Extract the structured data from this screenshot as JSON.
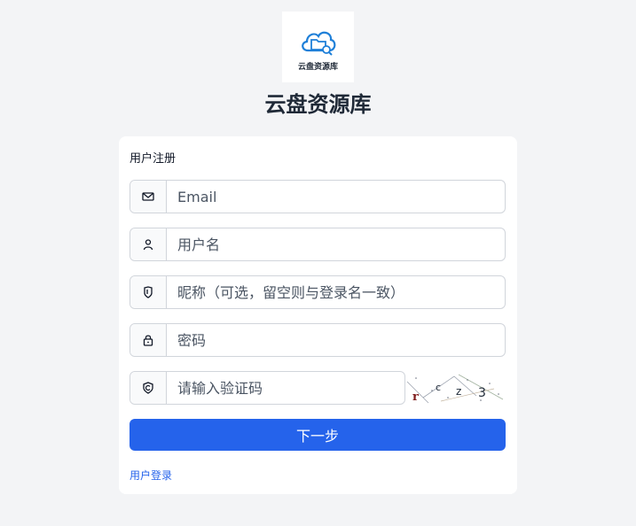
{
  "header": {
    "logo_caption": "云盘资源库",
    "site_title": "云盘资源库"
  },
  "form": {
    "title": "用户注册",
    "email": {
      "placeholder": "Email",
      "icon": "mail-icon"
    },
    "username": {
      "placeholder": "用户名",
      "icon": "user-icon"
    },
    "nickname": {
      "placeholder": "昵称（可选，留空则与登录名一致）",
      "icon": "badge-icon"
    },
    "password": {
      "placeholder": "密码",
      "icon": "lock-icon"
    },
    "captcha": {
      "placeholder": "请输入验证码",
      "icon": "shield-icon",
      "image_chars": [
        "r",
        "c",
        "z",
        "3"
      ]
    },
    "submit_label": "下一步",
    "login_link": "用户登录"
  },
  "colors": {
    "background": "#f3f4f6",
    "primary": "#2563eb",
    "logo_blue": "#1e7fd8"
  }
}
